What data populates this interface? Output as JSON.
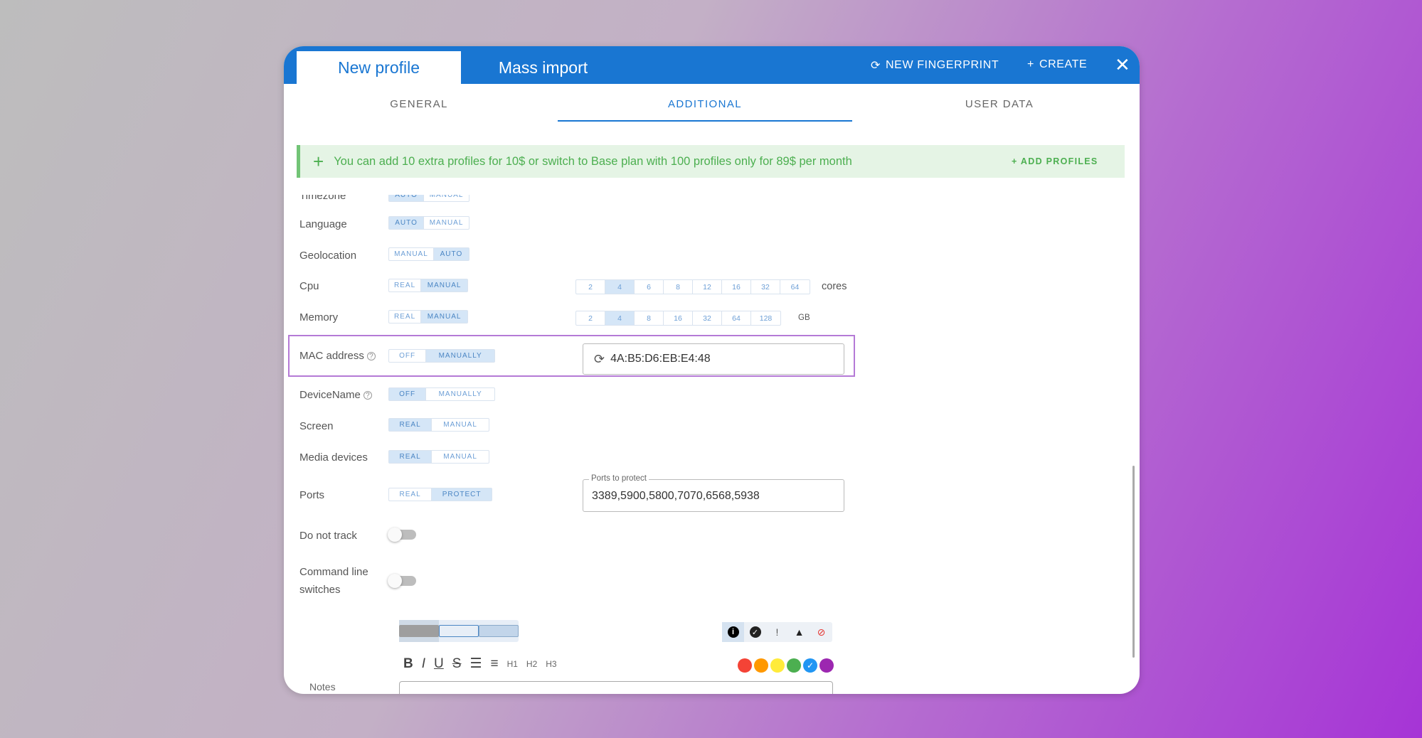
{
  "header": {
    "tabs": [
      {
        "label": "New profile"
      },
      {
        "label": "Mass import"
      }
    ],
    "new_fingerprint": "NEW FINGERPRINT",
    "create": "CREATE",
    "close_icon": "close-icon",
    "colors": {
      "brand": "#1976d2"
    }
  },
  "subtabs": [
    {
      "label": "GENERAL"
    },
    {
      "label": "ADDITIONAL"
    },
    {
      "label": "USER DATA"
    }
  ],
  "banner": {
    "text": "You can add 10 extra profiles for 10$ or switch to Base plan with 100 profiles only for 89$ per month",
    "action": "+ ADD PROFILES"
  },
  "rows": {
    "timezone": {
      "label": "Timezone",
      "options": [
        "AUTO",
        "MANUAL"
      ]
    },
    "language": {
      "label": "Language",
      "options": [
        "AUTO",
        "MANUAL"
      ]
    },
    "geolocation": {
      "label": "Geolocation",
      "options": [
        "MANUAL",
        "AUTO"
      ]
    },
    "cpu": {
      "label": "Cpu",
      "options": [
        "REAL",
        "MANUAL"
      ],
      "values": [
        "2",
        "4",
        "6",
        "8",
        "12",
        "16",
        "32",
        "64"
      ],
      "unit": "cores"
    },
    "memory": {
      "label": "Memory",
      "options": [
        "REAL",
        "MANUAL"
      ],
      "values": [
        "2",
        "4",
        "8",
        "16",
        "32",
        "64",
        "128"
      ],
      "unit": "GB"
    },
    "mac": {
      "label": "MAC address",
      "options": [
        "OFF",
        "MANUALLY"
      ],
      "value": "4A:B5:D6:EB:E4:48"
    },
    "device_name": {
      "label": "DeviceName",
      "options": [
        "OFF",
        "MANUALLY"
      ]
    },
    "screen": {
      "label": "Screen",
      "options": [
        "REAL",
        "MANUAL"
      ]
    },
    "media": {
      "label": "Media devices",
      "options": [
        "REAL",
        "MANUAL"
      ]
    },
    "ports": {
      "label": "Ports",
      "options": [
        "REAL",
        "PROTECT"
      ],
      "field_label": "Ports to protect",
      "value": "3389,5900,5800,7070,6568,5938"
    },
    "dnt": {
      "label": "Do not track"
    },
    "cmd": {
      "label_line1": "Command line",
      "label_line2": "switches"
    }
  },
  "notes": {
    "label": "Notes",
    "toolbar": [
      "B",
      "I",
      "U",
      "S",
      "H1",
      "H2",
      "H3"
    ],
    "colors": [
      "#f44336",
      "#ff9800",
      "#ffeb3b",
      "#4caf50",
      "#2196f3",
      "#9c27b0"
    ]
  }
}
